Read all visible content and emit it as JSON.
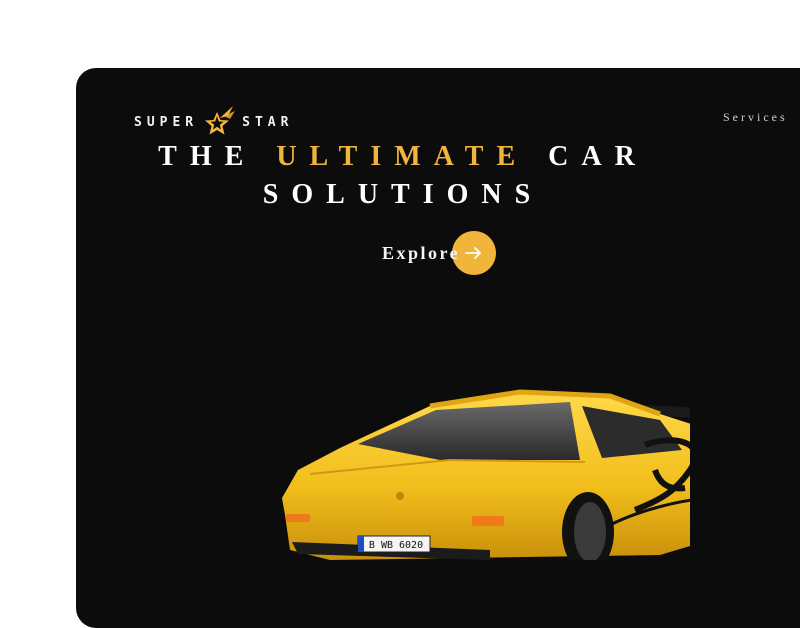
{
  "brand": {
    "left_text": "SUPER",
    "right_text": "STAR",
    "logo_icon": "shooting-star-icon"
  },
  "nav": {
    "services_label": "Services"
  },
  "hero": {
    "headline_word_1": "THE",
    "headline_word_accent": "ULTIMATE",
    "headline_word_3": "CAR",
    "headline_line_2": "SOLUTIONS",
    "explore_label": "Explore",
    "explore_icon": "arrow-right-icon",
    "license_plate": "B WB 6020"
  },
  "colors": {
    "background": "#0c0c0c",
    "accent": "#f2b53c",
    "text": "#ffffff",
    "car_body": "#f2c21e"
  }
}
